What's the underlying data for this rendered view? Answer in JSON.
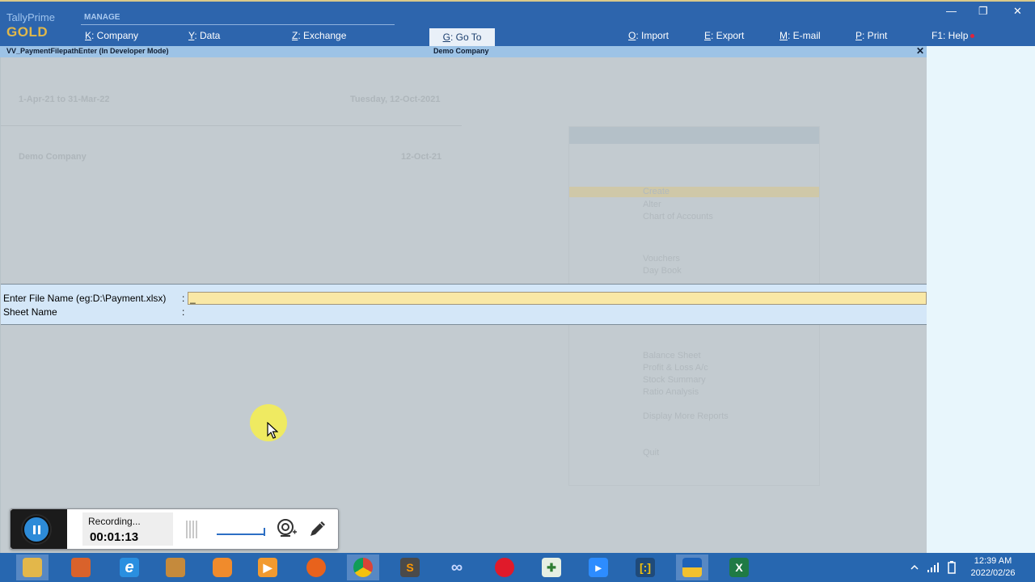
{
  "app": {
    "brand_name": "TallyPrime",
    "brand_tier": "GOLD",
    "manage_label": "MANAGE"
  },
  "menu": {
    "company": {
      "key": "K",
      "label": ": Company"
    },
    "data": {
      "key": "Y",
      "label": ": Data"
    },
    "exchange": {
      "key": "Z",
      "label": ": Exchange"
    },
    "goto": {
      "key": "G",
      "label": ": Go To"
    },
    "import": {
      "key": "O",
      "label": ": Import"
    },
    "export": {
      "key": "E",
      "label": ": Export"
    },
    "email": {
      "key": "M",
      "label": ": E-mail"
    },
    "print": {
      "key": "P",
      "label": ": Print"
    },
    "help": {
      "key": "F1",
      "label": ": Help"
    }
  },
  "window_controls": {
    "minimize": "—",
    "restore": "❐",
    "close": "✕"
  },
  "titlebar": {
    "report_name": "VV_PaymentFilepathEnter (In Developer Mode)",
    "company": "Demo Company",
    "close": "✕"
  },
  "background": {
    "period": "1-Apr-21 to 31-Mar-22",
    "current_date": "Tuesday, 12-Oct-2021",
    "company_name": "Demo Company",
    "last_entry_date": "12-Oct-21",
    "gateway_items": [
      "Create",
      "Alter",
      "Chart of Accounts",
      "Vouchers",
      "Day Book",
      "Balance Sheet",
      "Profit & Loss A/c",
      "Stock Summary",
      "Ratio Analysis",
      "Display More Reports",
      "Quit"
    ]
  },
  "form": {
    "file_label": "Enter File Name (eg:D:\\Payment.xlsx)",
    "file_colon": ":",
    "file_value": "_",
    "sheet_label": "Sheet Name",
    "sheet_colon": ":"
  },
  "recorder": {
    "status": "Recording...",
    "elapsed": "00:01:13"
  },
  "taskbar": {
    "apps": [
      "file-explorer",
      "store",
      "internet-explorer",
      "paint",
      "uc-browser",
      "media-player",
      "firefox",
      "chrome",
      "sublime-text",
      "infinity",
      "opera",
      "notepad-plus",
      "zoom",
      "brackets",
      "tallyprime",
      "excel"
    ],
    "time": "12:39 AM",
    "date": "2022/02/26"
  },
  "colors": {
    "topbar": "#2d65ad",
    "titlebar": "#9dc3e6",
    "input_highlight": "#f9e8a6",
    "taskbar": "#2767b0"
  }
}
